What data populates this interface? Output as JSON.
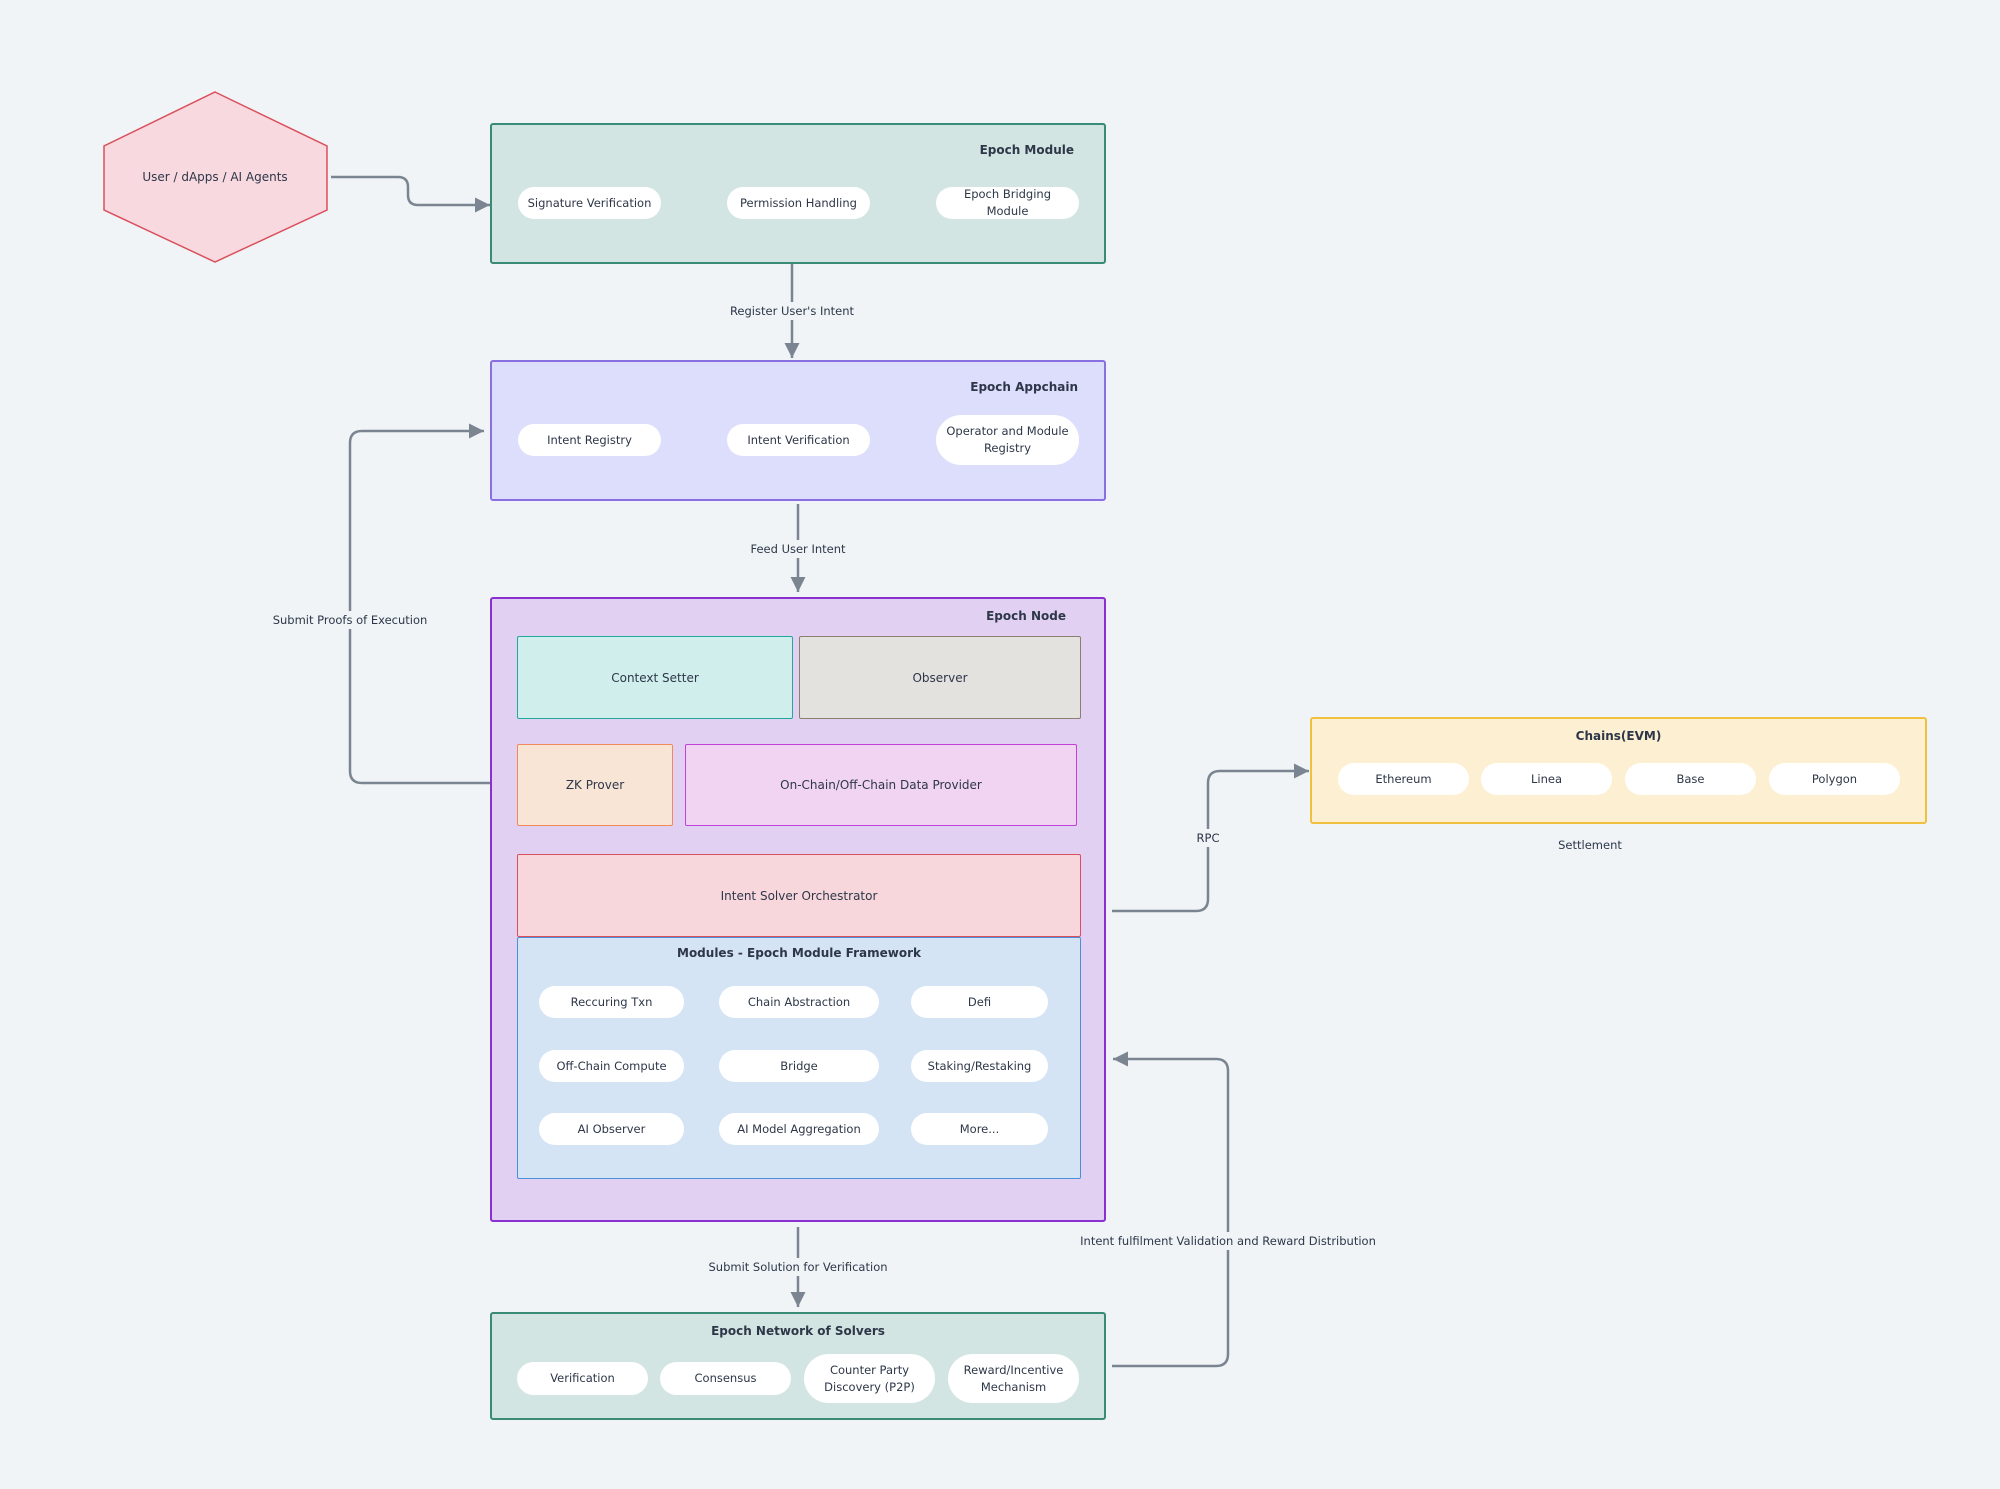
{
  "actor": {
    "label": "User / dApps /  AI Agents",
    "fill": "#f8d9df",
    "stroke": "#d9505c"
  },
  "epoch_module": {
    "title": "Epoch  Module",
    "items": [
      "Signature Verification",
      "Permission Handling",
      "Epoch Bridging Module"
    ],
    "fill": "#d2e5e2",
    "stroke": "#3a8a78"
  },
  "edge_labels": {
    "register": "Register User's Intent",
    "feed": "Feed User Intent",
    "proofs": "Submit Proofs of Execution",
    "rpc": "RPC",
    "submit_solution": "Submit Solution for Verification",
    "reward": "Intent fulfilment Validation and Reward Distribution",
    "settlement": "Settlement"
  },
  "epoch_appchain": {
    "title": "Epoch Appchain",
    "items": [
      "Intent Registry",
      "Intent Verification",
      "Operator and Module Registry"
    ],
    "fill": "#ddddfc",
    "stroke": "#8a6fe0"
  },
  "epoch_node": {
    "title": "Epoch Node",
    "fill": "#e2d0f3",
    "stroke": "#8a2fd0",
    "context_setter": "Context Setter",
    "observer": "Observer",
    "zk_prover": "ZK Prover",
    "data_provider": "On-Chain/Off-Chain Data Provider",
    "orchestrator": "Intent Solver Orchestrator",
    "modules": {
      "title": "Modules - Epoch Module Framework",
      "items": [
        "Reccuring Txn",
        "Chain Abstraction",
        "Defi",
        "Off-Chain Compute",
        "Bridge",
        "Staking/Restaking",
        "AI Observer",
        "AI Model Aggregation",
        "More..."
      ]
    }
  },
  "chains": {
    "title": "Chains(EVM)",
    "items": [
      "Ethereum",
      "Linea",
      "Base",
      "Polygon"
    ],
    "fill": "#fdf0d2",
    "stroke": "#f0c040"
  },
  "solvers": {
    "title": "Epoch Network of Solvers",
    "items": [
      "Verification",
      "Consensus",
      "Counter Party Discovery (P2P)",
      "Reward/Incentive Mechanism"
    ]
  }
}
